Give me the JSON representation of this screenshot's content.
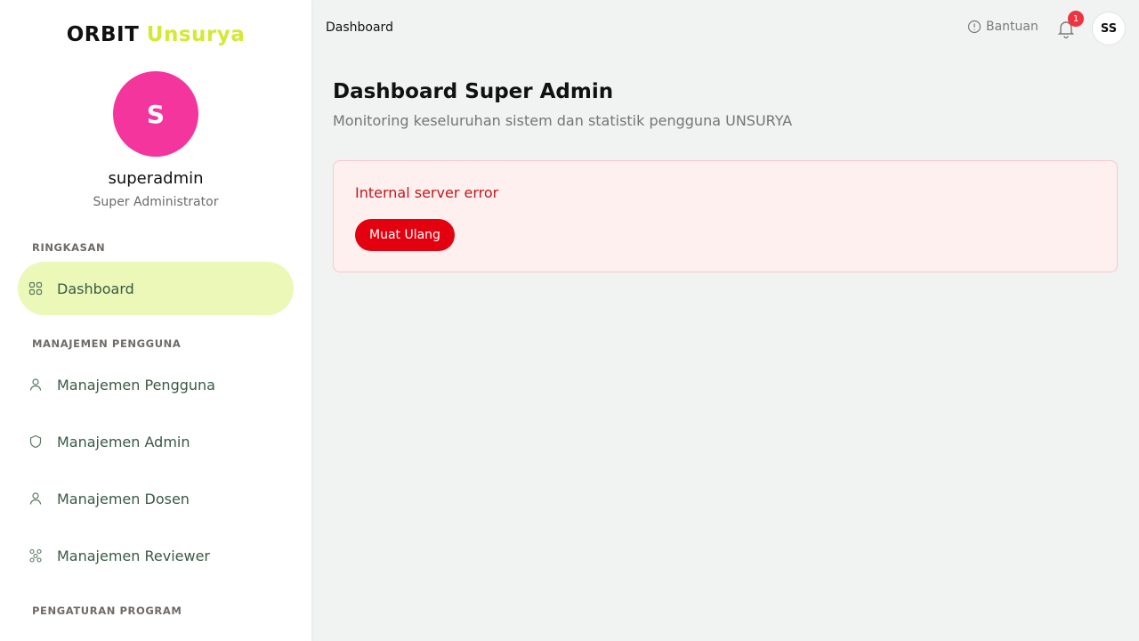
{
  "sidebar": {
    "brand_main": "ORBIT",
    "brand_accent": "Unsurya",
    "avatar_initial": "S",
    "user_name": "superadmin",
    "user_role": "Super Administrator",
    "sections": {
      "summary": "RINGKASAN",
      "user_mgmt": "MANAJEMEN PENGGUNA",
      "program": "PENGATURAN PROGRAM"
    },
    "items": {
      "dashboard": "Dashboard",
      "users": "Manajemen Pengguna",
      "admins": "Manajemen Admin",
      "lecturers": "Manajemen Dosen",
      "reviewers": "Manajemen Reviewer"
    }
  },
  "topbar": {
    "title": "Dashboard",
    "help_label": "Bantuan",
    "notification_count": "1",
    "avatar_initials": "SS"
  },
  "main": {
    "title": "Dashboard Super Admin",
    "subtitle": "Monitoring keseluruhan sistem dan statistik pengguna UNSURYA",
    "error_message": "Internal server error",
    "retry_label": "Muat Ulang"
  },
  "colors": {
    "accent_lime": "#d4e836",
    "active_nav_bg": "#ebf8b7",
    "avatar_pink": "#f5359e",
    "error_red": "#e3000f",
    "badge_red": "#ef3340"
  },
  "icons": {
    "dashboard": "grid-icon",
    "users": "user-icon",
    "admins": "shield-icon",
    "lecturers": "user-icon",
    "reviewers": "network-icon",
    "help": "info-circle-icon",
    "notifications": "bell-icon"
  }
}
